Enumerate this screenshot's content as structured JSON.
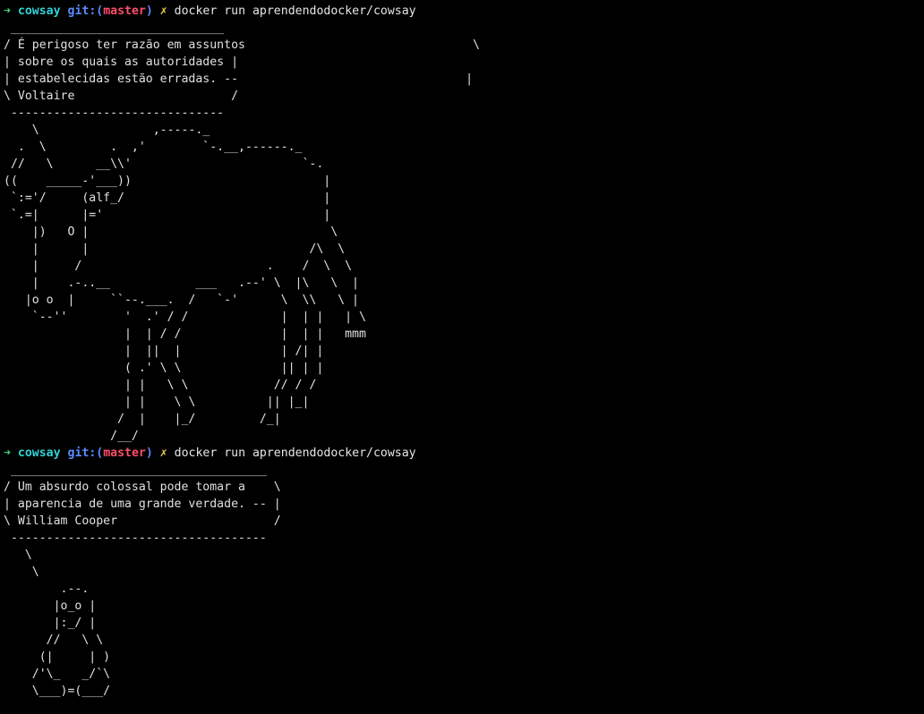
{
  "terminal": {
    "colors": {
      "background": "#000000",
      "arrow": "#3fd87a",
      "dir": "#2fd3d6",
      "git": "#5a8cff",
      "branch": "#ff4f6a",
      "dirty": "#e6cf52",
      "text": "#e0e0e0"
    },
    "sessions": [
      {
        "prompt": {
          "arrow": "➜",
          "dir": "cowsay",
          "git_prefix": "git:(",
          "branch": "master",
          "git_suffix": ")",
          "dirty_mark": "✗",
          "command": "docker run aprendendodocker/cowsay"
        },
        "output": [
          " ______________________________",
          "/ É perigoso ter razão em assuntos                                \\",
          "| sobre os quais as autoridades |",
          "| estabelecidas estão erradas. --                                |",
          "\\ Voltaire                      /",
          " ------------------------------",
          "    \\                ,-----._",
          "  .  \\         .  ,'        `-.__,------._",
          " //   \\      __\\\\'                        `-.",
          "((    _____-'___))                           |",
          " `:='/     (alf_/                            |",
          " `.=|      |='                               |",
          "    |)   O |                                  \\",
          "    |      |                               /\\  \\",
          "    |     /                          .    /  \\  \\",
          "    |    .-..__            ___   .--' \\  |\\   \\  |",
          "   |o o  |     ``--.___.  /   `-'      \\  \\\\   \\ |",
          "    `--''        '  .' / /             |  | |   | \\",
          "                 |  | / /              |  | |   mmm",
          "                 |  ||  |              | /| |",
          "                 ( .' \\ \\              || | |",
          "                 | |   \\ \\            // / /",
          "                 | |    \\ \\          || |_|",
          "                /  |    |_/         /_|",
          "               /__/"
        ]
      },
      {
        "prompt": {
          "arrow": "➜",
          "dir": "cowsay",
          "git_prefix": "git:(",
          "branch": "master",
          "git_suffix": ")",
          "dirty_mark": "✗",
          "command": "docker run aprendendodocker/cowsay"
        },
        "output": [
          " ____________________________________",
          "/ Um absurdo colossal pode tomar a    \\",
          "| aparencia de uma grande verdade. -- |",
          "\\ William Cooper                      /",
          " ------------------------------------",
          "   \\",
          "    \\",
          "        .--.",
          "       |o_o |",
          "       |:_/ |",
          "      //   \\ \\",
          "     (|     | )",
          "    /'\\_   _/`\\",
          "    \\___)=(___/"
        ]
      }
    ]
  }
}
